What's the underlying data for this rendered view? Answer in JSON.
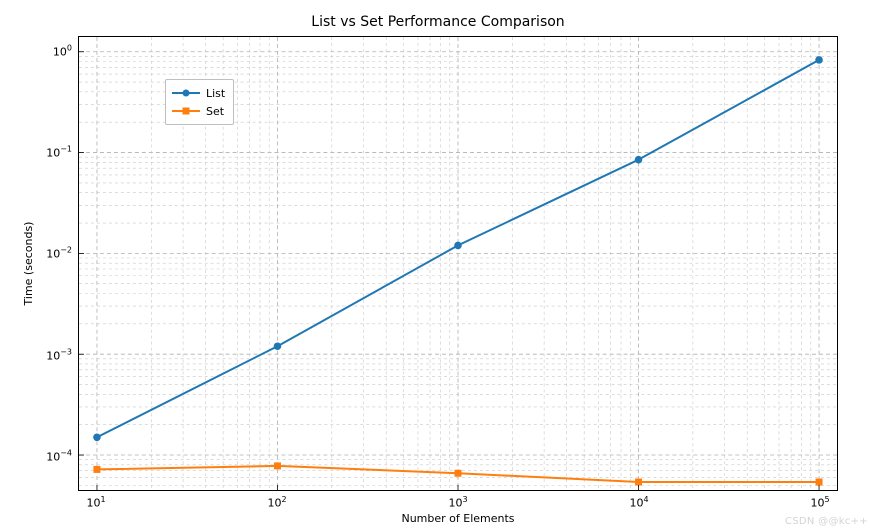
{
  "chart_data": {
    "type": "line",
    "title": "List vs Set Performance Comparison",
    "xlabel": "Number of Elements",
    "ylabel": "Time (seconds)",
    "x": [
      10,
      100,
      1000,
      10000,
      100000
    ],
    "series": [
      {
        "name": "List",
        "values": [
          0.00015,
          0.0012,
          0.012,
          0.085,
          0.83
        ],
        "color": "#1f77b4",
        "marker": "circle"
      },
      {
        "name": "Set",
        "values": [
          7.2e-05,
          7.8e-05,
          6.6e-05,
          5.4e-05,
          5.4e-05
        ],
        "color": "#ff7f0e",
        "marker": "square"
      }
    ],
    "xscale": "log",
    "yscale": "log",
    "xlim": [
      10,
      100000
    ],
    "ylim": [
      4.5e-05,
      1.4
    ],
    "xticks": [
      10,
      100,
      1000,
      10000,
      100000
    ],
    "yticks": [
      0.0001,
      0.001,
      0.01,
      0.1,
      1
    ],
    "x_log_sublines": [
      2,
      3,
      4,
      5,
      6,
      7,
      8,
      9
    ],
    "y_log_sublines": [
      2,
      3,
      4,
      5,
      6,
      7,
      8,
      9
    ],
    "grid": true,
    "grid_style": "dashed",
    "legend_position": "upper left"
  },
  "watermark": "CSDN @@kc++"
}
